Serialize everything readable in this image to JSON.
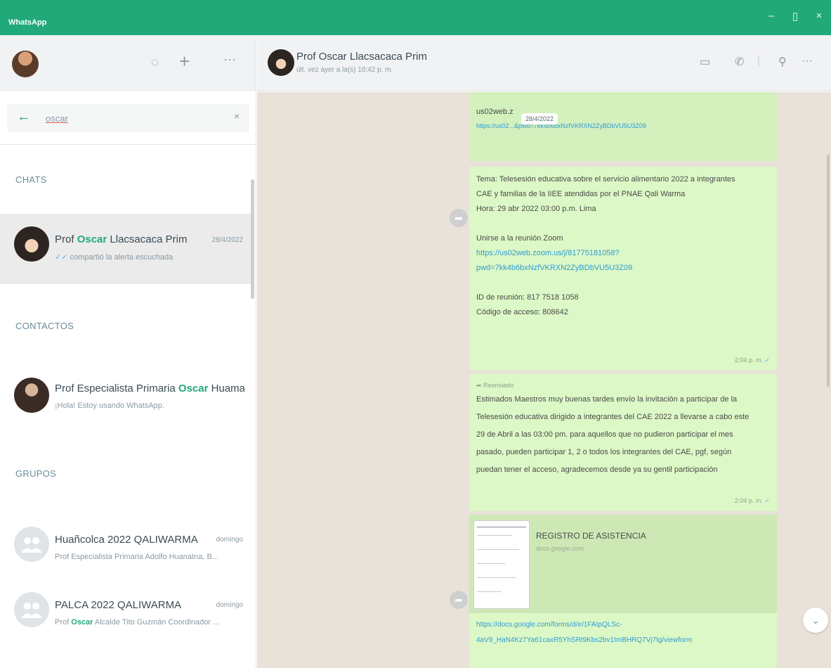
{
  "window": {
    "title": "WhatsApp",
    "minimize": "–",
    "maximize": "▯",
    "close": "×"
  },
  "sidebar": {
    "search": {
      "value": "oscar"
    },
    "sections": {
      "chats": "CHATS",
      "contacts": "CONTACTOS",
      "groups": "GRUPOS"
    },
    "chats": [
      {
        "name_pre": "Prof ",
        "name_match": "Oscar",
        "name_post": " Llacsacaca Prim",
        "time": "28/4/2022",
        "preview": "compartió la alerta escuchada"
      }
    ],
    "contacts": [
      {
        "name_pre": "Prof Especialista Primaria ",
        "name_match": "Oscar",
        "name_post": " Huama...",
        "status": "¡Hola! Estoy usando WhatsApp."
      }
    ],
    "groups": [
      {
        "name": "Huañcolca 2022 QALIWARMA",
        "time": "domingo",
        "preview_pre": "Prof Especialista Primaria Adolfo Huanatna, B...",
        "preview_match": "",
        "preview_post": ""
      },
      {
        "name": "PALCA 2022 QALIWARMA",
        "time": "domingo",
        "preview_pre": "Prof ",
        "preview_match": "Oscar",
        "preview_post": " Alcalde Tito Guzmán Coordinador ..."
      }
    ]
  },
  "chat": {
    "name": "Prof Oscar Llacsacaca Prim",
    "status": "últ. vez ayer a la(s) 10:42 p. m.",
    "date_chip": "28/4/2022",
    "messages": [
      {
        "id": "m1",
        "line1": "us02web.z",
        "link": "https://us02...&pwd=7kk4b6bxNzfVKRXN2ZyBDbVU5U3Z09",
        "time": ""
      },
      {
        "id": "m2",
        "line1": "Tema: Telesesión educativa sobre el servicio alimentario 2022 a integrantes",
        "line2": "CAE y familias de la IIEE atendidas por el PNAE Qali Warma",
        "line3": "Hora: 29 abr 2022 03:00 p.m. Lima",
        "line4": "Unirse a la reunión Zoom",
        "link1": "https://us02web.zoom.us/j/81775181058?",
        "link2": "pwd=7kk4b6bxNzfVKRXN2ZyBDbVU5U3Z09",
        "line5": "ID de reunión: 817 7518 1058",
        "line6": "Código de acceso: 808642",
        "time": "2:04 p. m."
      },
      {
        "id": "m3",
        "forwarded": "Reenviado",
        "text1": "Estimados Maestros muy buenas tardes envío la invitación a participar de la",
        "text2": "Telesesión educativa dirigido a integrantes del CAE 2022 a llevarse a cabo este",
        "text3": "29 de Abril a las 03:00 pm. para aquellos que no pudieron participar el mes",
        "text4": "pasado, pueden participar 1, 2 o todos los integrantes del CAE, pgf, según",
        "text5": "puedan tener el acceso, agradecemos desde ya su gentil participación",
        "time": "2:04 p. m."
      },
      {
        "id": "m4",
        "doc_title": "REGISTRO DE ASISTENCIA",
        "doc_sub": "docs.google.com",
        "link1": "https://docs.google.com/forms/d/e/1FAIpQLSc-",
        "link2": "4aV9_HaN4Kz7Ya61caxR5YhSRt9Kbs2bv1ImBHRQ7Vj7tg/viewform"
      }
    ]
  },
  "colors": {
    "brand": "#21a979",
    "bubble": "#dcf8c6",
    "link": "#2e9bd6",
    "chat_bg": "#e8e2d9"
  }
}
